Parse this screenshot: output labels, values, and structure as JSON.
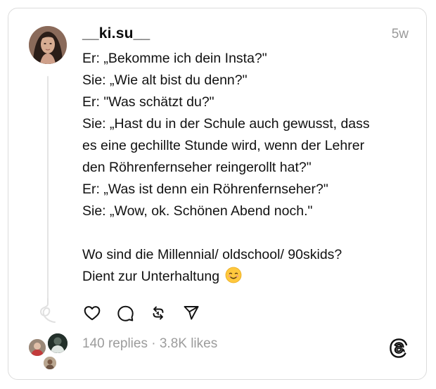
{
  "post": {
    "username": "__ki.su__",
    "timestamp": "5w",
    "lines": [
      "Er: „Bekomme ich dein Insta?\"",
      "Sie: „Wie alt bist du denn?\"",
      "Er: \"Was schätzt du?\"",
      "Sie: „Hast du in der Schule auch gewusst, dass",
      "es eine gechillte Stunde wird, wenn der Lehrer",
      "den Röhrenfernseher reingerollt hat?\"",
      "Er: „Was ist denn ein Röhrenfernseher?\"",
      "Sie: „Wow, ok. Schönen Abend noch.\""
    ],
    "closing_lines": [
      "Wo sind die Millennial/ oldschool/ 90skids?",
      "Dient zur Unterhaltung"
    ],
    "emoji": "smiling-face-emoji"
  },
  "actions": {
    "like_icon": "heart-icon",
    "reply_icon": "comment-icon",
    "repost_icon": "repost-icon",
    "share_icon": "send-icon"
  },
  "stats": {
    "replies": "140 replies",
    "separator": " · ",
    "likes": "3.8K likes"
  },
  "brand": {
    "logo_icon": "threads-logo-icon"
  }
}
